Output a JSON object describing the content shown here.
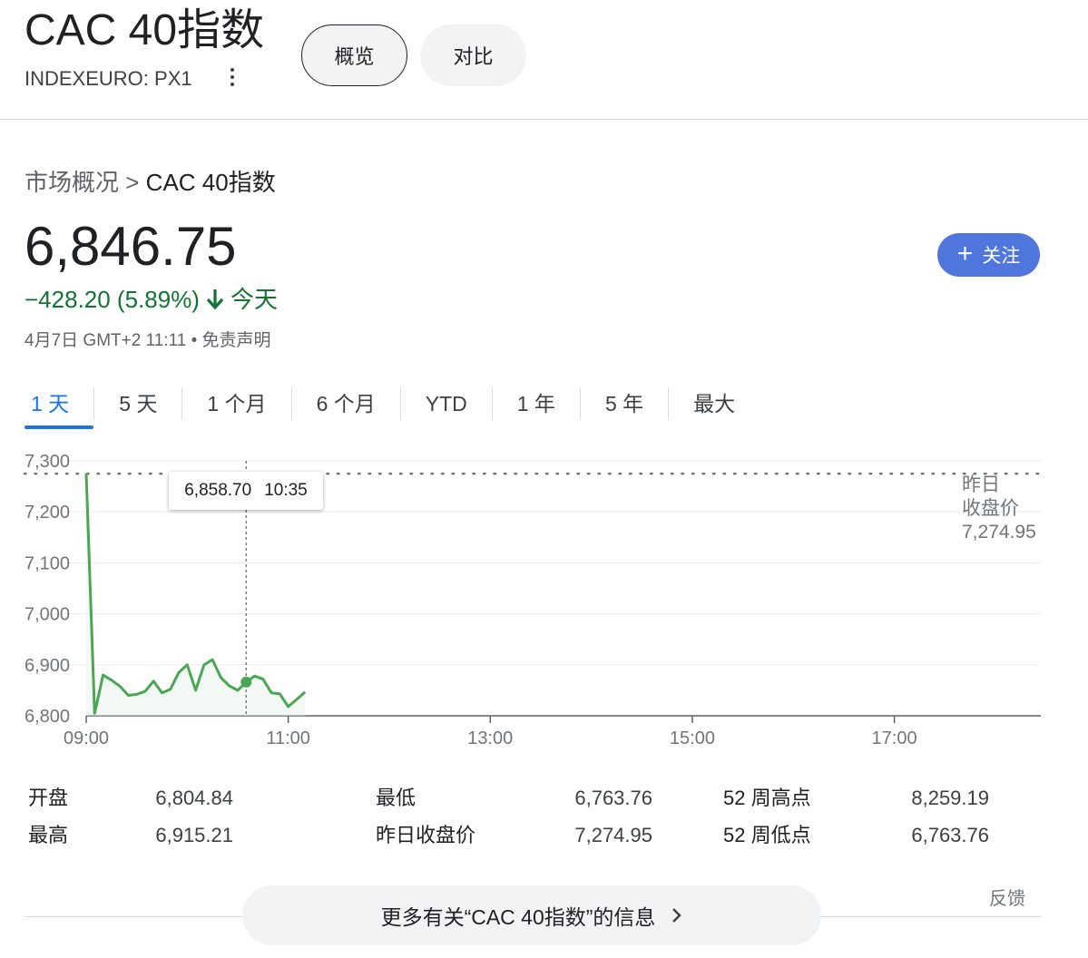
{
  "header": {
    "title": "CAC 40指数",
    "ticker": "INDEXEURO: PX1",
    "tabs": [
      "概览",
      "对比"
    ]
  },
  "breadcrumb": {
    "parent": "市场概况",
    "separator": ">",
    "current": "CAC 40指数"
  },
  "quote": {
    "price": "6,846.75",
    "change": "−428.20 (5.89%)",
    "change_period": "今天",
    "direction": "down",
    "timestamp": "4月7日 GMT+2 11:11 • 免责声明"
  },
  "follow_button": {
    "icon": "plus-icon",
    "label": "关注"
  },
  "ranges": [
    {
      "label": "1 天",
      "selected": true
    },
    {
      "label": "5 天",
      "selected": false
    },
    {
      "label": "1 个月",
      "selected": false
    },
    {
      "label": "6 个月",
      "selected": false
    },
    {
      "label": "YTD",
      "selected": false
    },
    {
      "label": "1 年",
      "selected": false
    },
    {
      "label": "5 年",
      "selected": false
    },
    {
      "label": "最大",
      "selected": false
    }
  ],
  "chart_data": {
    "type": "line",
    "series": [
      {
        "x": [
          "09:00",
          "09:05",
          "09:10",
          "09:15",
          "09:20",
          "09:25",
          "09:30",
          "09:35",
          "09:40",
          "09:45",
          "09:50",
          "09:55",
          "10:00",
          "10:05",
          "10:10",
          "10:15",
          "10:20",
          "10:25",
          "10:30",
          "10:35",
          "10:40",
          "10:45",
          "10:50",
          "10:55",
          "11:00",
          "11:05",
          "11:10"
        ],
        "values": [
          7274.95,
          6804.84,
          6880,
          6870,
          6858,
          6840,
          6842,
          6848,
          6868,
          6845,
          6852,
          6885,
          6900,
          6850,
          6900,
          6910,
          6875,
          6858.7,
          6850,
          6866,
          6878,
          6872,
          6845,
          6843,
          6818,
          6832,
          6846.75
        ]
      }
    ],
    "x_ticks": [
      "09:00",
      "11:00",
      "13:00",
      "15:00",
      "17:00"
    ],
    "x_range_hours": [
      9,
      18.45
    ],
    "y_ticks": [
      7300,
      7200,
      7100,
      7000,
      6900,
      6800
    ],
    "y_tick_labels": [
      "7,300",
      "7,200",
      "7,100",
      "7,000",
      "6,900",
      "6,800"
    ],
    "ylim": [
      6800,
      7300
    ],
    "previous_close": 7274.95,
    "previous_close_label": [
      "昨日",
      "收盘价",
      "7,274.95"
    ],
    "tooltip": {
      "value": "6,858.70",
      "time": "10:35"
    },
    "grid": true,
    "line_color": "#4aa653"
  },
  "stats": [
    {
      "label": "开盘",
      "value": "6,804.84"
    },
    {
      "label": "最高",
      "value": "6,915.21"
    },
    {
      "label": "最低",
      "value": "6,763.76"
    },
    {
      "label": "昨日收盘价",
      "value": "7,274.95"
    },
    {
      "label": "52 周高点",
      "value": "8,259.19"
    },
    {
      "label": "52 周低点",
      "value": "6,763.76"
    }
  ],
  "feedback": "反馈",
  "more_button": {
    "label": "更多有关“CAC 40指数”的信息",
    "icon": "chevron-right-icon"
  }
}
